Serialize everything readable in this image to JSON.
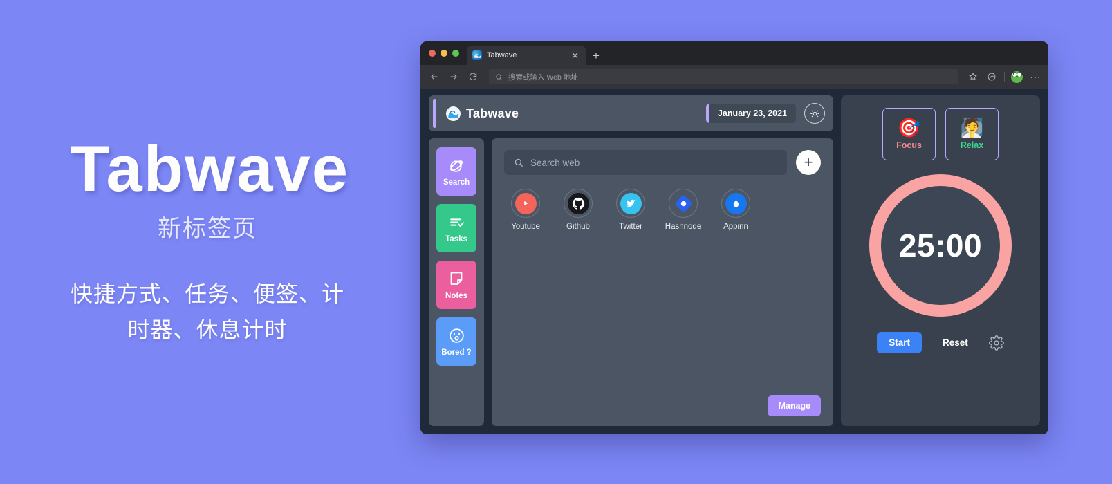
{
  "promo": {
    "title": "Tabwave",
    "subtitle": "新标签页",
    "description": "快捷方式、任务、便签、计时器、休息计时"
  },
  "browser": {
    "traffic_lights": [
      "close",
      "minimize",
      "zoom"
    ],
    "tab": {
      "title": "Tabwave",
      "favicon": "tabwave-wave-icon",
      "close_label": "✕"
    },
    "new_tab_label": "+",
    "nav": {
      "back": "back-arrow",
      "forward": "forward-arrow",
      "reload": "reload-arrow"
    },
    "omnibox": {
      "placeholder": "搜索或输入 Web 地址",
      "icon": "search-icon"
    },
    "toolbar_icons": [
      "favorites-star-icon",
      "collections-icon",
      "profile-avatar"
    ],
    "overflow_label": "···"
  },
  "app": {
    "header": {
      "brand": "Tabwave",
      "logo_icon": "wave-icon",
      "date": "January 23, 2021",
      "theme_toggle_icon": "sun-icon"
    },
    "sidebar": {
      "items": [
        {
          "label": "Search",
          "icon": "planet-icon",
          "color": "#a78bfa"
        },
        {
          "label": "Tasks",
          "icon": "checklist-icon",
          "color": "#34c98b"
        },
        {
          "label": "Notes",
          "icon": "sticky-note-icon",
          "color": "#ec5f9e"
        },
        {
          "label": "Bored ?",
          "icon": "surprised-face-icon",
          "color": "#5b9cf8"
        }
      ]
    },
    "search": {
      "placeholder": "Search web",
      "icon": "search-icon",
      "add_label": "+"
    },
    "shortcuts": [
      {
        "label": "Youtube",
        "icon": "youtube-icon",
        "color": "#f4645b"
      },
      {
        "label": "Github",
        "icon": "github-icon",
        "color": "#17181c"
      },
      {
        "label": "Twitter",
        "icon": "twitter-icon",
        "color": "#36c3f0"
      },
      {
        "label": "Hashnode",
        "icon": "hashnode-icon",
        "color": "#2962ef"
      },
      {
        "label": "Appinn",
        "icon": "appinn-icon",
        "color": "#1677ef"
      }
    ],
    "manage_label": "Manage",
    "pomodoro": {
      "modes": [
        {
          "label": "Focus",
          "emoji": "🎯",
          "color": "#f08a8a"
        },
        {
          "label": "Relax",
          "emoji": "🧖",
          "color": "#3dd68c"
        }
      ],
      "time": "25:00",
      "ring_color": "#f9a3a3",
      "start_label": "Start",
      "reset_label": "Reset",
      "settings_icon": "gear-icon"
    }
  }
}
